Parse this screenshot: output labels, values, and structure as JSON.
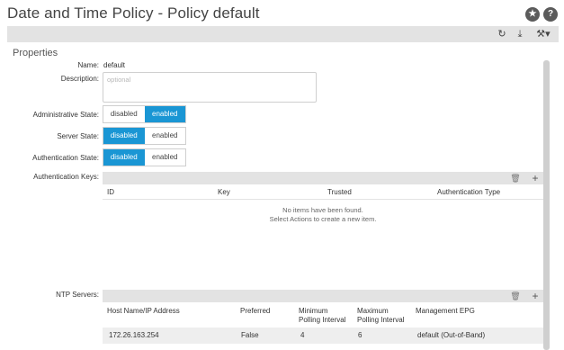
{
  "header": {
    "title": "Date and Time Policy - Policy default",
    "star_glyph": "★",
    "help_glyph": "?"
  },
  "toolbar": {
    "icons": [
      "refresh-icon",
      "download-icon",
      "tools-icon"
    ],
    "refresh_glyph": "↻",
    "download_glyph": "⤓",
    "tools_glyph": "⚒▾"
  },
  "properties": {
    "section_title": "Properties",
    "name_label": "Name:",
    "name_value": "default",
    "description_label": "Description:",
    "description_placeholder": "optional",
    "admin_state": {
      "label": "Administrative State:",
      "options": [
        "disabled",
        "enabled"
      ],
      "selected": "enabled"
    },
    "server_state": {
      "label": "Server State:",
      "options": [
        "disabled",
        "enabled"
      ],
      "selected": "disabled"
    },
    "auth_state": {
      "label": "Authentication State:",
      "options": [
        "disabled",
        "enabled"
      ],
      "selected": "disabled"
    }
  },
  "auth_keys": {
    "label": "Authentication Keys:",
    "trash_glyph": "🗑",
    "add_glyph": "+",
    "columns": [
      "ID",
      "Key",
      "Trusted",
      "Authentication Type"
    ],
    "empty_line1": "No items have been found.",
    "empty_line2": "Select Actions to create a new item."
  },
  "ntp_servers": {
    "label": "NTP Servers:",
    "trash_glyph": "🗑",
    "add_glyph": "+",
    "columns": [
      "Host Name/IP Address",
      "Preferred",
      "Minimum\nPolling Interval",
      "Maximum\nPolling Interval",
      "Management EPG"
    ],
    "rows": [
      [
        "172.26.163.254",
        "False",
        "4",
        "6",
        "default (Out-of-Band)"
      ]
    ]
  },
  "colors": {
    "accent": "#1a96d4",
    "bar_bg": "#e3e3e3"
  }
}
